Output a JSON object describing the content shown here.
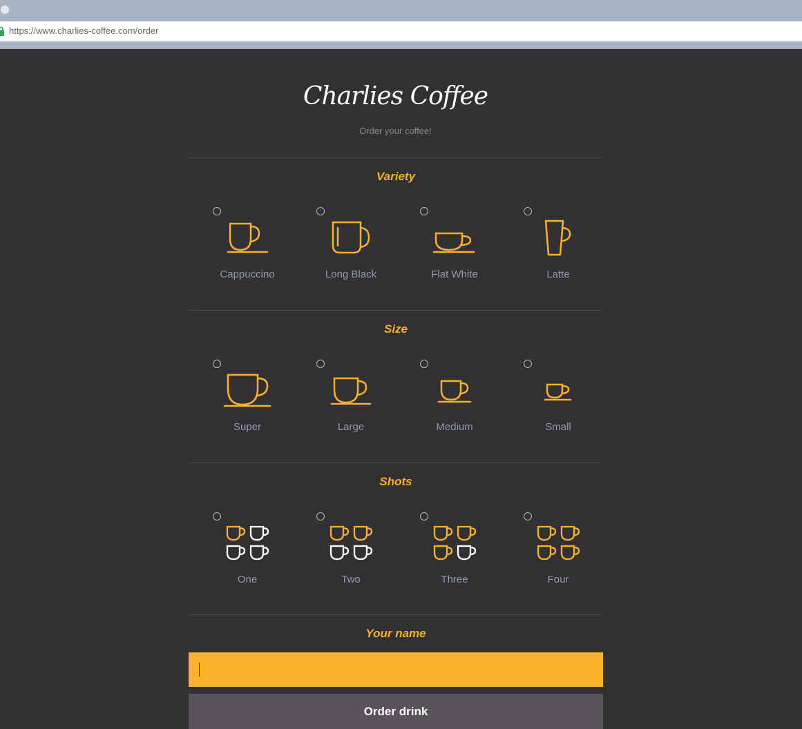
{
  "browser": {
    "url": "https://www.charlies-coffee.com/order"
  },
  "brand": {
    "logo_text": "Charlies Coffee",
    "tagline": "Order your coffee!"
  },
  "sections": {
    "variety": {
      "title": "Variety",
      "options": [
        {
          "label": "Cappuccino",
          "icon": "cappuccino-cup-icon"
        },
        {
          "label": "Long Black",
          "icon": "long-black-mug-icon"
        },
        {
          "label": "Flat White",
          "icon": "flat-white-cup-icon"
        },
        {
          "label": "Latte",
          "icon": "latte-glass-icon"
        }
      ]
    },
    "size": {
      "title": "Size",
      "options": [
        {
          "label": "Super",
          "icon": "super-cup-icon"
        },
        {
          "label": "Large",
          "icon": "large-cup-icon"
        },
        {
          "label": "Medium",
          "icon": "medium-cup-icon"
        },
        {
          "label": "Small",
          "icon": "small-cup-icon"
        }
      ]
    },
    "shots": {
      "title": "Shots",
      "options": [
        {
          "label": "One",
          "icon": "one-shot-icon",
          "filled": 1
        },
        {
          "label": "Two",
          "icon": "two-shots-icon",
          "filled": 2
        },
        {
          "label": "Three",
          "icon": "three-shots-icon",
          "filled": 3
        },
        {
          "label": "Four",
          "icon": "four-shots-icon",
          "filled": 4
        }
      ]
    },
    "name": {
      "title": "Your name",
      "value": "",
      "placeholder": ""
    }
  },
  "order_button": {
    "label": "Order drink"
  },
  "colors": {
    "accent": "#fbb12c",
    "background": "#333033",
    "label": "#8d9cb0",
    "button": "#595459"
  }
}
